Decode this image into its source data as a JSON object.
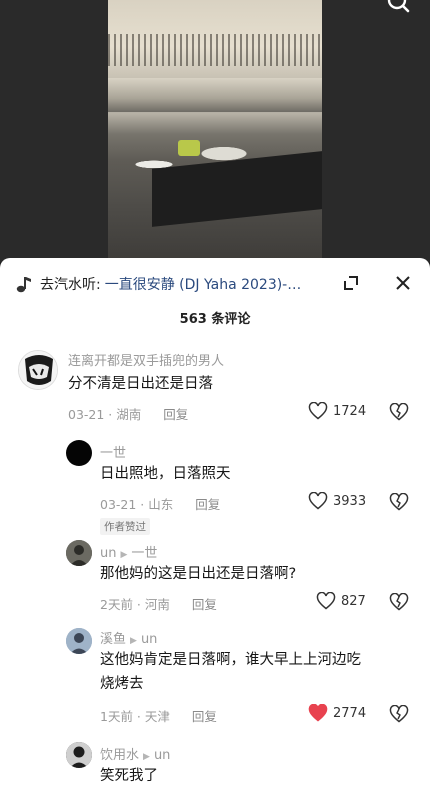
{
  "video": {
    "search_icon": "search-icon"
  },
  "music": {
    "icon": "music-note-icon",
    "prefix": "去汽水听:",
    "song": "一直很安静 (DJ Yaha 2023)-…"
  },
  "header": {
    "count_label": "563 条评论"
  },
  "comments": [
    {
      "username": "连离开都是双手插兜的男人",
      "text": "分不清是日出还是日落",
      "date": "03-21",
      "location": "湖南",
      "reply": "回复",
      "likes": "1724",
      "liked": false
    },
    {
      "username": "一世",
      "text": "日出照地，日落照天",
      "date": "03-21",
      "location": "山东",
      "reply": "回复",
      "likes": "3933",
      "liked": false,
      "badge": "作者赞过"
    },
    {
      "username": "un",
      "reply_to": "一世",
      "text": "那他妈的这是日出还是日落啊?",
      "date": "2天前",
      "location": "河南",
      "reply": "回复",
      "likes": "827",
      "liked": false
    },
    {
      "username": "溪鱼",
      "reply_to": "un",
      "text_line1": "这他妈肯定是日落啊，谁大早上上河边吃",
      "text_line2": "烧烤去",
      "date": "1天前",
      "location": "天津",
      "reply": "回复",
      "likes": "2774",
      "liked": true
    },
    {
      "username": "饮用水",
      "reply_to": "un",
      "text": "笑死我了"
    }
  ],
  "colors": {
    "liked_heart": "#e8424f",
    "link": "#2b4a7e"
  }
}
